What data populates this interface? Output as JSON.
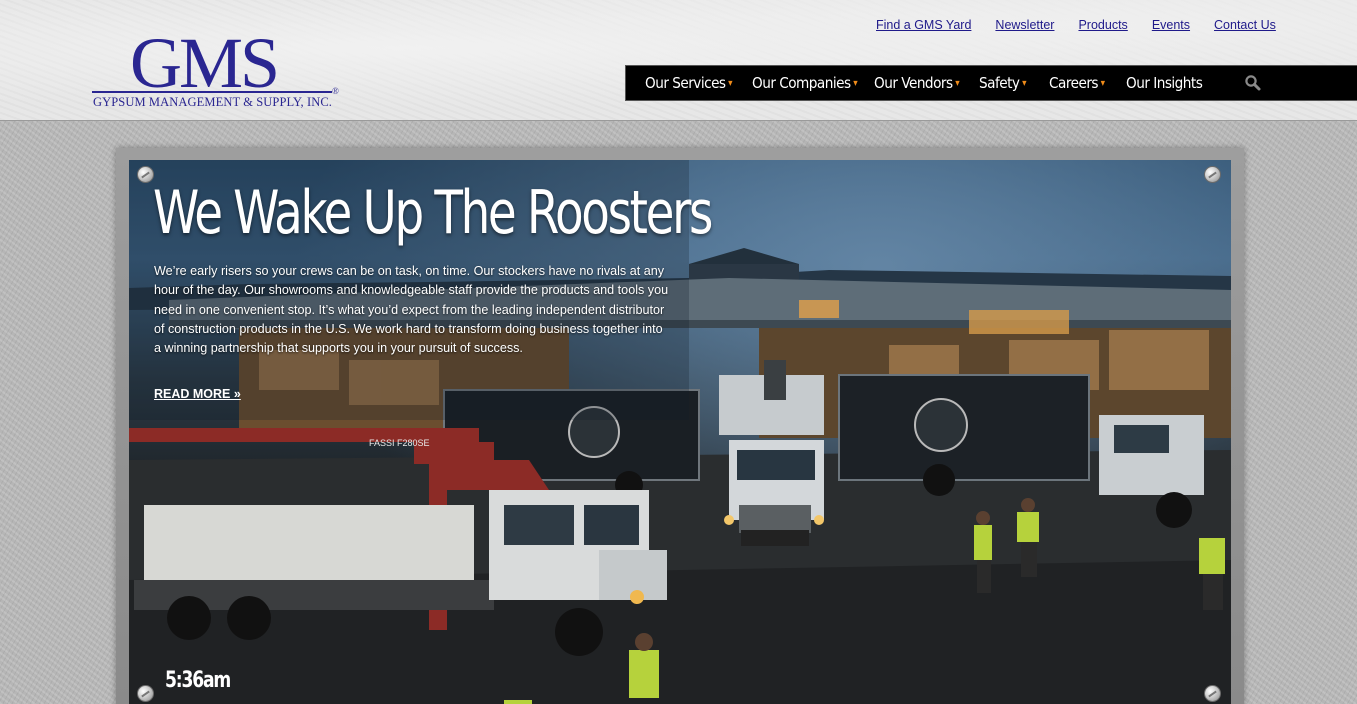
{
  "header": {
    "logo_mark": "GMS",
    "logo_subtitle": "GYPSUM MANAGEMENT & SUPPLY, INC.",
    "logo_registered": "®",
    "top_links": [
      "Find a GMS Yard",
      "Newsletter",
      "Products",
      "Events",
      "Contact Us"
    ],
    "nav": [
      {
        "label": "Our Services",
        "caret": "▾"
      },
      {
        "label": "Our Companies",
        "caret": "▾"
      },
      {
        "label": "Our Vendors",
        "caret": "▾"
      },
      {
        "label": "Safety",
        "caret": "▾"
      },
      {
        "label": "Careers",
        "caret": "▾"
      },
      {
        "label": "Our Insights",
        "caret": ""
      }
    ],
    "search_icon": "search-icon"
  },
  "hero": {
    "title": "We Wake Up The Roosters",
    "body": "We’re early risers so your crews can be on task, on time. Our stockers have no rivals at any hour of the day. Our showrooms and knowledgeable staff provide the products and tools you need in one convenient stop. It’s what you’d expect from the leading independent distributor of construction products in the U.S. We work hard to transform doing business together into a winning partnership that supports you in your pursuit of success.",
    "read_more": "READ MORE »",
    "timestamp": "5:36am",
    "truck_label": "FASSI F280SE"
  },
  "colors": {
    "brand_blue": "#2a2691",
    "nav_background": "#000000",
    "caret_orange": "#f08c1a",
    "link_blue": "#1f1a8a"
  }
}
